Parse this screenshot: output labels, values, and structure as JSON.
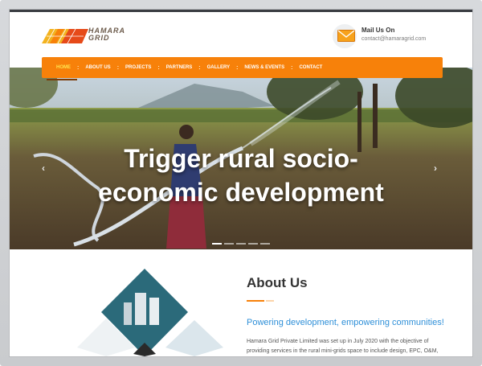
{
  "header": {
    "logo_text_line1": "HAMARA",
    "logo_text_line2": "GRID",
    "mail_title": "Mail Us On",
    "mail_address": "contact@hamaragrid.com",
    "mail_icon": "envelope-icon"
  },
  "nav": {
    "items": [
      {
        "label": "HOME",
        "active": true
      },
      {
        "label": "ABOUT US",
        "active": false
      },
      {
        "label": "PROJECTS",
        "active": false
      },
      {
        "label": "PARTNERS",
        "active": false
      },
      {
        "label": "GALLERY",
        "active": false
      },
      {
        "label": "NEWS & EVENTS",
        "active": false
      },
      {
        "label": "CONTACT",
        "active": false
      }
    ],
    "separator": ":"
  },
  "hero": {
    "title_line1": "Trigger rural socio-",
    "title_line2": "economic development",
    "prev_icon": "chevron-left-icon",
    "next_icon": "chevron-right-icon",
    "slides_total": 5,
    "slide_active": 1
  },
  "about": {
    "title": "About Us",
    "subtitle": "Powering development, empowering communities!",
    "body": "Hamara Grid Private Limited was set up in July 2020 with the objective of providing services in the rural mini-grids space to include design, EPC, O&M,"
  },
  "colors": {
    "accent": "#f7810a",
    "nav_active": "#ffe34d",
    "subtitle_blue": "#2e8fd8",
    "text_dark": "#333333"
  }
}
